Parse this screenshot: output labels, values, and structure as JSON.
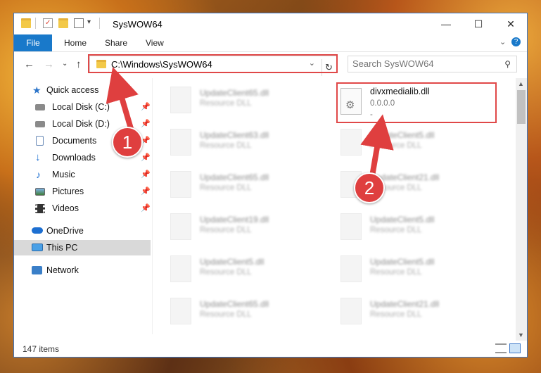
{
  "window": {
    "title": "SysWOW64",
    "controls": {
      "minimize": "—",
      "maximize": "☐",
      "close": "✕"
    }
  },
  "ribbon": {
    "tabs": [
      "File",
      "Home",
      "Share",
      "View"
    ],
    "expand": "⌄",
    "help": "?"
  },
  "nav": {
    "back": "←",
    "forward": "→",
    "recent": "⌄",
    "up": "↑",
    "address": "C:\\Windows\\SysWOW64",
    "address_drop": "⌄",
    "refresh": "↻",
    "search_placeholder": "Search SysWOW64",
    "search_icon": "⚲"
  },
  "sidebar": {
    "items": [
      {
        "label": "Quick access",
        "icon": "star-icon",
        "pinned": false
      },
      {
        "label": "Local Disk (C:)",
        "icon": "drive-icon",
        "pinned": true
      },
      {
        "label": "Local Disk (D:)",
        "icon": "drive-icon",
        "pinned": true
      },
      {
        "label": "Documents",
        "icon": "documents-icon",
        "pinned": true
      },
      {
        "label": "Downloads",
        "icon": "downloads-icon",
        "pinned": true
      },
      {
        "label": "Music",
        "icon": "music-icon",
        "pinned": true
      },
      {
        "label": "Pictures",
        "icon": "pictures-icon",
        "pinned": true
      },
      {
        "label": "Videos",
        "icon": "videos-icon",
        "pinned": true
      },
      {
        "label": "OneDrive",
        "icon": "onedrive-icon",
        "pinned": false
      },
      {
        "label": "This PC",
        "icon": "this-pc-icon",
        "pinned": false,
        "selected": true
      },
      {
        "label": "Network",
        "icon": "network-icon",
        "pinned": false
      }
    ],
    "pin_glyph": "📌"
  },
  "files": {
    "left": [
      {
        "name": "UpdateClient65.dll",
        "type": "Resource DLL"
      },
      {
        "name": "UpdateClient63.dll",
        "type": "Resource DLL"
      },
      {
        "name": "UpdateClient65.dll",
        "type": "Resource DLL"
      },
      {
        "name": "UpdateClient19.dll",
        "type": "Resource DLL"
      },
      {
        "name": "UpdateClient5.dll",
        "type": "Resource DLL"
      },
      {
        "name": "UpdateClient65.dll",
        "type": "Resource DLL"
      }
    ],
    "right": [
      {
        "name": "divxmedialib.dll",
        "version": "0.0.0.0",
        "extra": "-"
      },
      {
        "name": "UpdateClient5.dll",
        "type": "Resource DLL"
      },
      {
        "name": "UpdateClient21.dll",
        "type": "Resource DLL"
      },
      {
        "name": "UpdateClient5.dll",
        "type": "Resource DLL"
      },
      {
        "name": "UpdateClient5.dll",
        "type": "Resource DLL"
      },
      {
        "name": "UpdateClient21.dll",
        "type": "Resource DLL"
      }
    ]
  },
  "scrollbar": {
    "up": "▲",
    "down": "▼"
  },
  "status": {
    "item_count": "147 items"
  },
  "annotations": {
    "step1": "1",
    "step2": "2",
    "color": "#df3f3f"
  }
}
